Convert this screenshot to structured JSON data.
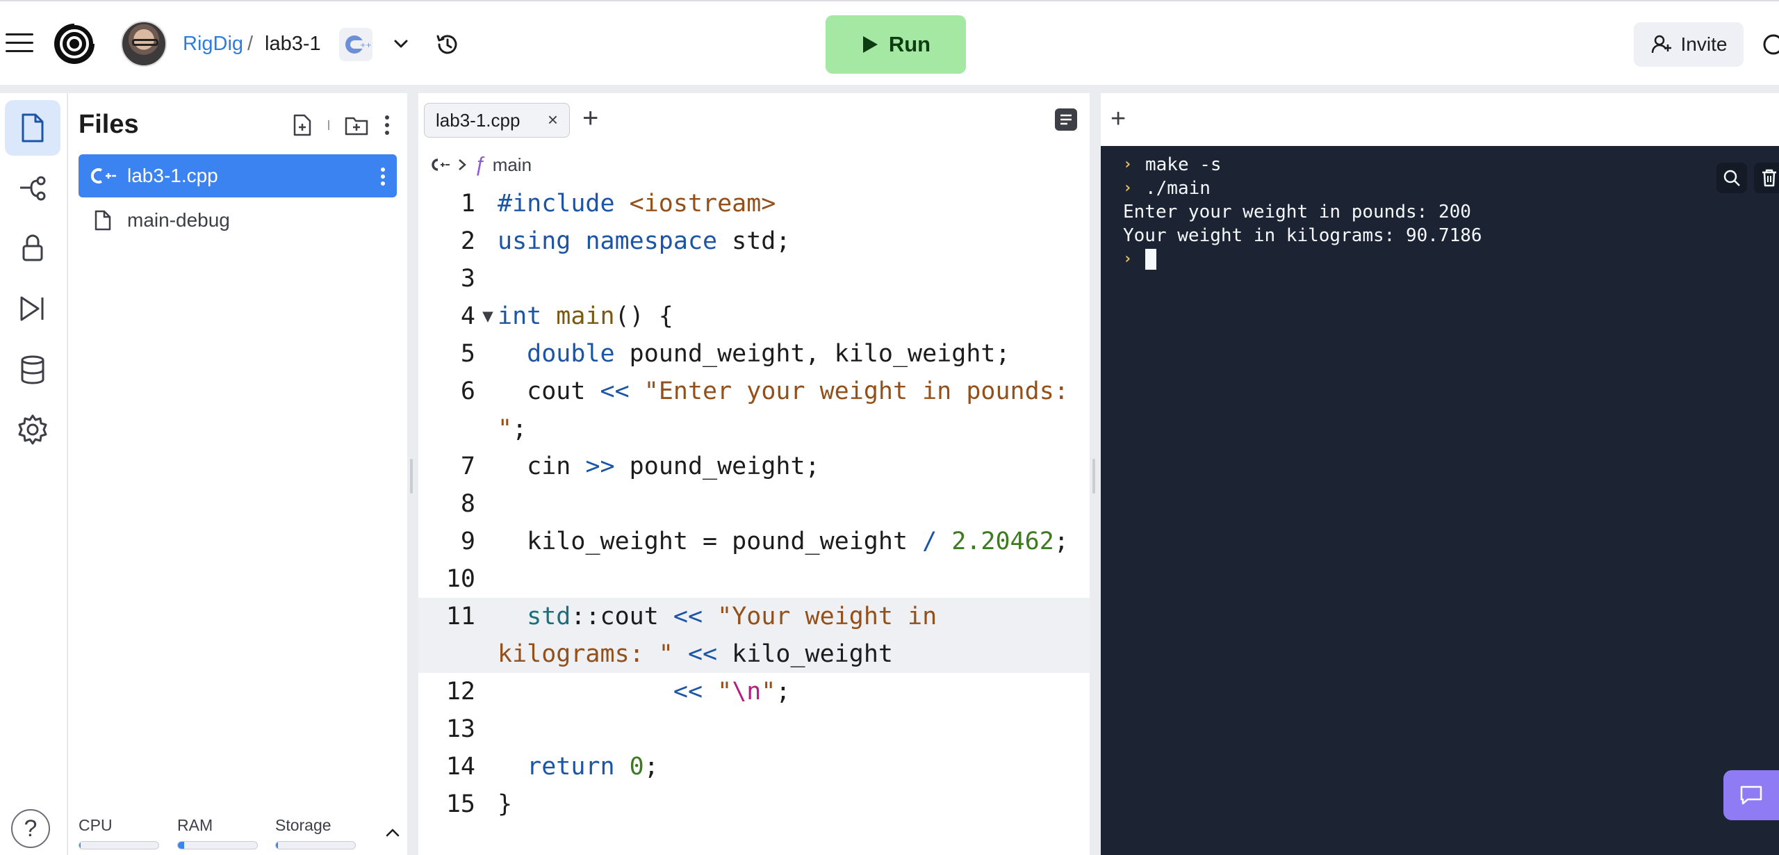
{
  "header": {
    "user": "RigDig",
    "separator": "/",
    "repl_name": "lab3-1",
    "run_label": "Run",
    "invite_label": "Invite"
  },
  "files_panel": {
    "title": "Files",
    "files": [
      {
        "name": "lab3-1.cpp",
        "icon": "cpp-icon",
        "active": true
      },
      {
        "name": "main-debug",
        "icon": "file-icon",
        "active": false
      }
    ],
    "resources": [
      {
        "label": "CPU",
        "level": 0.02
      },
      {
        "label": "RAM",
        "level": 0.08
      },
      {
        "label": "Storage",
        "level": 0.03
      }
    ]
  },
  "editor": {
    "tab_label": "lab3-1.cpp",
    "tab_close": "×",
    "breadcrumb_symbol": "ƒ",
    "breadcrumb_function": "main",
    "line_numbers": [
      "1",
      "2",
      "3",
      "4",
      "5",
      "6",
      "7",
      "8",
      "9",
      "10",
      "11",
      "12",
      "13",
      "14",
      "15"
    ]
  },
  "console": {
    "lines": [
      {
        "prompt": true,
        "text": "make -s"
      },
      {
        "prompt": true,
        "text": "./main"
      },
      {
        "prompt": false,
        "text": "Enter your weight in pounds: 200"
      },
      {
        "prompt": false,
        "text": "Your weight in kilograms: 90.7186"
      }
    ]
  },
  "colors": {
    "accent": "#3b83f0",
    "run_button": "#a4e8a3",
    "terminal_bg": "#1c2333",
    "prompt": "#e8c35a",
    "feedback": "#8f7cf5"
  }
}
